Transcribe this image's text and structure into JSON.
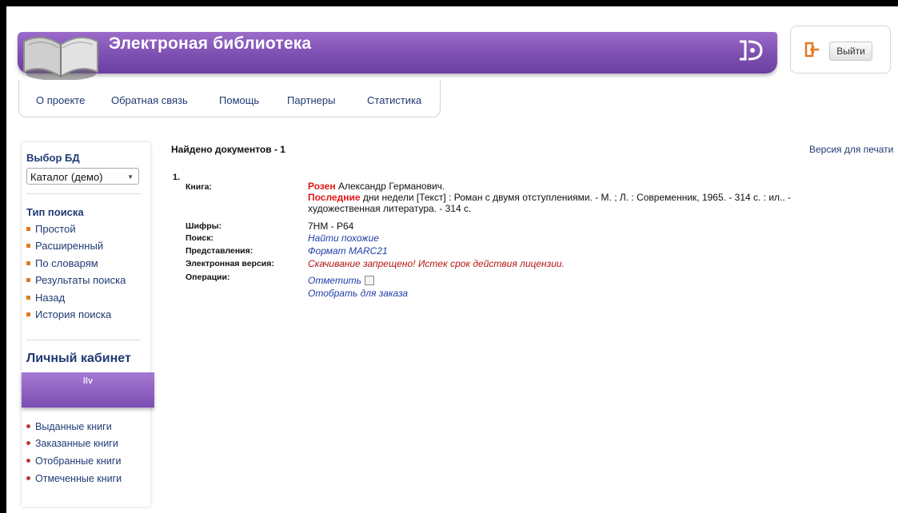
{
  "header": {
    "title": "Электроная библиотека",
    "logout_label": "Выйти",
    "colors": {
      "banner": "#7d4fb1",
      "link": "#1f3a73",
      "highlight": "#e01818"
    }
  },
  "topnav": {
    "items": [
      {
        "label": "О проекте"
      },
      {
        "label": "Обратная связь"
      },
      {
        "label": "Помощь"
      },
      {
        "label": "Партнеры"
      },
      {
        "label": "Статистика"
      }
    ]
  },
  "sidebar": {
    "db_heading": "Выбор БД",
    "db_selected": "Каталог (демо)",
    "search_type_heading": "Тип поиска",
    "search_links": [
      {
        "label": "Простой"
      },
      {
        "label": "Расширенный"
      },
      {
        "label": "По словарям"
      },
      {
        "label": "Результаты поиска"
      },
      {
        "label": "Назад"
      },
      {
        "label": "История поиска"
      }
    ],
    "cabinet_title": "Личный кабинет",
    "user": "llv",
    "cabinet_links": [
      {
        "label": "Выданные книги"
      },
      {
        "label": "Заказанные книги"
      },
      {
        "label": "Отобранные книги"
      },
      {
        "label": "Отмеченные книги"
      }
    ]
  },
  "results": {
    "found": "Найдено документов - 1",
    "print_version": "Версия для печати",
    "record": {
      "number": "1.",
      "labels": {
        "book": "Книга:",
        "codes": "Шифры:",
        "search": "Поиск:",
        "views": "Представления:",
        "electronic": "Электронная версия:",
        "operations": "Операции:"
      },
      "author_hl": "Розен",
      "author_rest": " Александр Германович.",
      "title_hl": "Последние",
      "title_rest": " дни недели [Текст] : Роман с двумя отступлениями. - М. ; Л. : Современник, 1965. - 314 с. : ил.. -",
      "title_rest2": "художественная литература. - 314 с.",
      "codes": "7НМ - Р64",
      "find_similar": "Найти похожие",
      "format": "Формат MARC21",
      "electronic_status": "Скачивание запрещено! Истек срок действия лицензии.",
      "mark_label": "Отметить",
      "order_label": "Отобрать для заказа"
    }
  }
}
